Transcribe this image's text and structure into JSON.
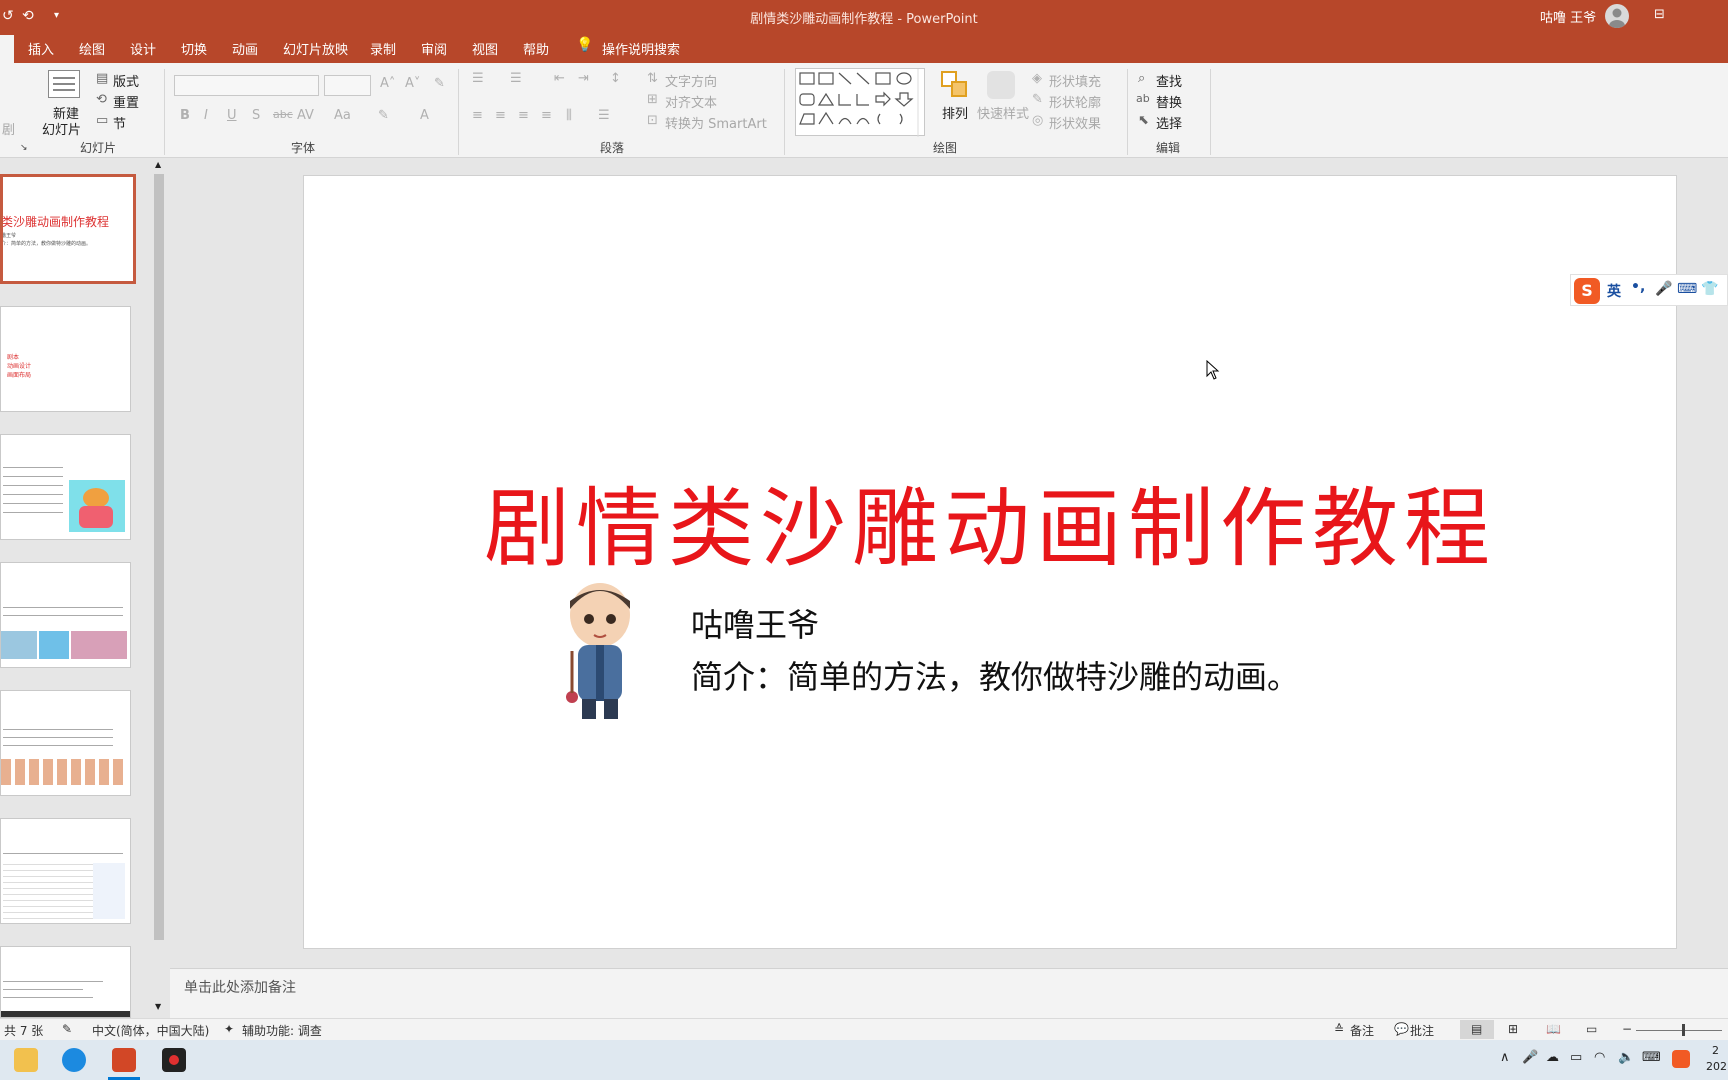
{
  "titlebar": {
    "title": "剧情类沙雕动画制作教程  -  PowerPoint",
    "user": "咕噜 王爷"
  },
  "tabs": [
    "插入",
    "绘图",
    "设计",
    "切换",
    "动画",
    "幻灯片放映",
    "录制",
    "审阅",
    "视图",
    "帮助",
    "操作说明搜索"
  ],
  "ribbon": {
    "slides_group": {
      "new_slide": [
        "新建",
        "幻灯片"
      ],
      "layout": "版式",
      "reset": "重置",
      "section": "节",
      "label": "幻灯片"
    },
    "font_group": {
      "label": "字体",
      "bold": "B",
      "italic": "I",
      "underline": "U",
      "shadow": "S",
      "strike": "abc",
      "spacing": "AV",
      "case": "Aa",
      "color": "A"
    },
    "paragraph_group": {
      "label": "段落",
      "text_direction": "文字方向",
      "align_text": "对齐文本",
      "smartart": "转换为 SmartArt"
    },
    "drawing_group": {
      "label": "绘图",
      "arrange": "排列",
      "quick_styles": "快速样式",
      "shape_fill": "形状填充",
      "shape_outline": "形状轮廓",
      "shape_effects": "形状效果"
    },
    "editing_group": {
      "label": "编辑",
      "find": "查找",
      "replace": "替换",
      "select": "选择"
    }
  },
  "thumbnails": [
    {
      "title": "类沙雕动画制作教程",
      "line1": "噜王爷",
      "line2": "介：简单的方法，教你做特沙雕的动画。"
    },
    {
      "lines": [
        "剧本",
        "动画设计",
        "画面布局"
      ]
    },
    {},
    {},
    {},
    {},
    {}
  ],
  "slide": {
    "title": "剧情类沙雕动画制作教程",
    "author": "咕噜王爷",
    "description": "简介：简单的方法，教你做特沙雕的动画。"
  },
  "ime": {
    "lang": "英",
    "punct": "•,"
  },
  "notes_placeholder": "单击此处添加备注",
  "statusbar": {
    "slide_count": "共 7 张",
    "language": "中文(简体，中国大陆)",
    "accessibility": "辅助功能: 调查",
    "notes": "备注",
    "comments": "批注"
  },
  "colors": {
    "accent": "#b7472a",
    "title_red": "#e8161a"
  }
}
